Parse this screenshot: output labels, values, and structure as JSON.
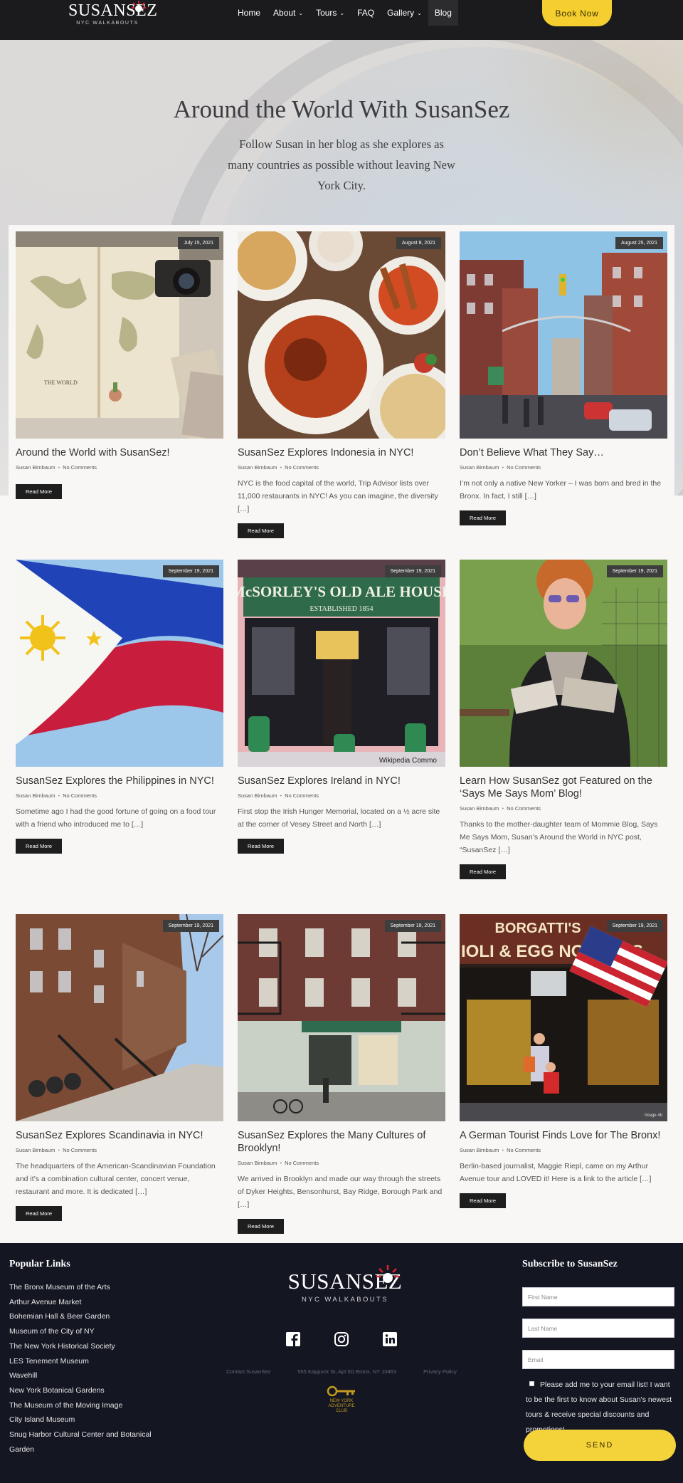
{
  "header": {
    "logo_text": "SUSANSEZ",
    "logo_sub": "NYC WALKABOUTS",
    "nav": [
      {
        "label": "Home",
        "has_menu": false
      },
      {
        "label": "About",
        "has_menu": true
      },
      {
        "label": "Tours",
        "has_menu": true
      },
      {
        "label": "FAQ",
        "has_menu": false
      },
      {
        "label": "Gallery",
        "has_menu": true
      },
      {
        "label": "Blog",
        "has_menu": false
      }
    ],
    "book_button": "Book Now"
  },
  "hero": {
    "title": "Around the World With SusanSez",
    "subtitle": "Follow Susan in her blog as she explores as many countries as possible without leaving New York City."
  },
  "posts": [
    {
      "date": "July 15, 2021",
      "title": "Around the World with SusanSez!",
      "author": "Susan Birnbaum",
      "comments": "No Comments",
      "excerpt": "",
      "more": "Read More"
    },
    {
      "date": "August 8, 2021",
      "title": "SusanSez Explores Indonesia in NYC!",
      "author": "Susan Birnbaum",
      "comments": "No Comments",
      "excerpt": "NYC is the food capital of the world, Trip Advisor lists over 11,000 restaurants in NYC! As you can imagine, the diversity […]",
      "more": "Read More"
    },
    {
      "date": "August 25, 2021",
      "title": "Don’t Believe What They Say…",
      "author": "Susan Birnbaum",
      "comments": "No Comments",
      "excerpt": "I’m not only a native New Yorker – I was born and bred in the Bronx.  In fact, I still […]",
      "more": "Read More"
    },
    {
      "date": "September 19, 2021",
      "title": "SusanSez Explores the Philippines in NYC!",
      "author": "Susan Birnbaum",
      "comments": "No Comments",
      "excerpt": "Sometime ago I had the good fortune of going on a food tour with a friend who introduced me to […]",
      "more": "Read More"
    },
    {
      "date": "September 19, 2021",
      "title": "SusanSez Explores Ireland in NYC!",
      "author": "Susan Birnbaum",
      "comments": "No Comments",
      "excerpt": "First stop the Irish Hunger Memorial, located on a ½ acre site at the corner of Vesey Street and North […]",
      "more": "Read More"
    },
    {
      "date": "September 19, 2021",
      "title": "Learn How SusanSez got Featured on the ‘Says Me Says Mom’ Blog!",
      "author": "Susan Birnbaum",
      "comments": "No Comments",
      "excerpt": "Thanks to the mother-daughter team of Mommie Blog, Says Me Says Mom, Susan’s Around the World in NYC post, “SusanSez […]",
      "more": "Read More"
    },
    {
      "date": "September 19, 2021",
      "title": "SusanSez Explores Scandinavia in NYC!",
      "author": "Susan Birnbaum",
      "comments": "No Comments",
      "excerpt": "The headquarters of the American-Scandinavian Foundation and it’s a combination cultural center, concert venue, restaurant and more. It is dedicated […]",
      "more": "Read More"
    },
    {
      "date": "September 19, 2021",
      "title": "SusanSez Explores the Many Cultures of Brooklyn!",
      "author": "Susan Birnbaum",
      "comments": "No Comments",
      "excerpt": "We arrived in Brooklyn and made our way through the streets of Dyker Heights, Bensonhurst, Bay Ridge, Borough Park and […]",
      "more": "Read More"
    },
    {
      "date": "September 19, 2021",
      "title": "A German Tourist Finds Love for The Bronx!",
      "author": "Susan Birnbaum",
      "comments": "No Comments",
      "excerpt": "Berlin-based journalist, Maggie Riepl, came on my Arthur Avenue tour and LOVED it! Here is a link to the article […]",
      "more": "Read More"
    }
  ],
  "image_captions": {
    "ireland_credit": "Wikipedia Commo",
    "mcsorley_sign": "McSORLEY'S OLD ALE HOUSE",
    "mcsorley_est": "ESTABLISHED 1854",
    "borgatti_sign": "BORGATTI'S",
    "borgatti_sub": "IOLI & EGG NOODLES",
    "bronx_credit": "Image 4b",
    "map_label": "THE WORLD"
  },
  "footer": {
    "popular_heading": "Popular Links",
    "links": [
      "The Bronx Museum of the Arts",
      "Arthur Avenue Market",
      "Bohemian Hall & Beer Garden",
      "Museum of the City of NY",
      "The New York Historical Society",
      "LES Tenement Museum",
      "Wavehill",
      "New York Botanical Gardens",
      "The Museum of the Moving Image",
      "City Island Museum",
      "Snug Harbor Cultural Center and Botanical Garden"
    ],
    "logo_text": "SUSANSEZ",
    "logo_sub": "NYC WALKABOUTS",
    "contact": "Contact SusanSez",
    "address": "555 Kappock St, Apt 5D Bronx, NY 10463",
    "privacy": "Privacy Policy",
    "badge_line1": "NEW YORK",
    "badge_line2": "ADVENTURE CLUB",
    "subscribe_heading": "Subscribe to SusanSez",
    "first_name_placeholder": "First Name",
    "last_name_placeholder": "Last Name",
    "email_placeholder": "Email",
    "consent": "Please add me to your email list! I want to be the first to know about Susan's newest tours & receive special discounts and promotions!",
    "send": "SEND"
  },
  "colors": {
    "accent": "#f4cf2f",
    "header_bg": "#1b1b1d",
    "footer_bg": "#141622",
    "button_dark": "#1e1e1e"
  },
  "icons": [
    "sun-logo-icon",
    "chevron-down-icon",
    "facebook-icon",
    "instagram-icon",
    "linkedin-icon",
    "key-icon"
  ]
}
